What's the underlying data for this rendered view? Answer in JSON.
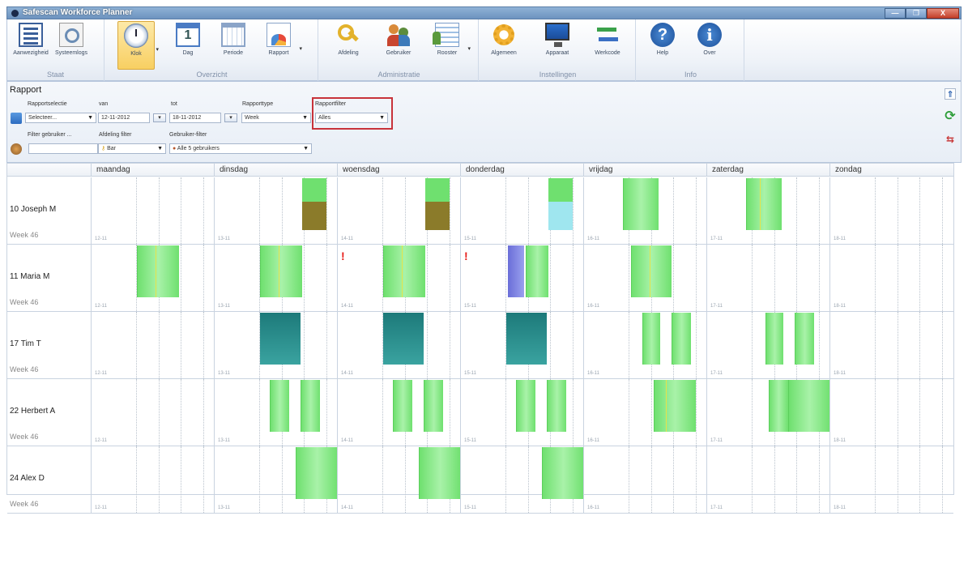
{
  "window": {
    "title": "Safescan Workforce Planner",
    "btn_min": "—",
    "btn_max": "❐",
    "btn_close": "X"
  },
  "ribbon": {
    "groups": [
      {
        "label": "Staat",
        "items": [
          "Aanwezigheid",
          "Systeemlogs"
        ]
      },
      {
        "label": "Overzicht",
        "items": [
          "Klok",
          "Dag",
          "Periode",
          "Rapport"
        ]
      },
      {
        "label": "Administratie",
        "items": [
          "Afdeling",
          "Gebruiker",
          "Rooster"
        ]
      },
      {
        "label": "Instellingen",
        "items": [
          "Algemeen",
          "Apparaat",
          "Werkcode"
        ]
      },
      {
        "label": "Info",
        "items": [
          "Help",
          "Over"
        ]
      }
    ]
  },
  "rapport": {
    "title": "Rapport",
    "rapportselectie_label": "Rapportselectie",
    "rapportselectie_value": "Selecteer...",
    "van_label": "van",
    "van_value": "12-11-2012",
    "tot_label": "tot",
    "tot_value": "18-11-2012",
    "rapporttype_label": "Rapporttype",
    "rapporttype_value": "Week",
    "rapportfilter_label": "Rapportfilter",
    "rapportfilter_value": "Alles",
    "filter_gebruiker_label": "Filter gebruiker ...",
    "filter_gebruiker_value": "",
    "afdeling_filter_label": "Afdeling filter",
    "afdeling_filter_value": "Bar",
    "gebruiker_filter_label": "Gebruiker-filter",
    "gebruiker_filter_value": "Alle 5 gebruikers"
  },
  "planner": {
    "days": [
      "maandag",
      "dinsdag",
      "woensdag",
      "donderdag",
      "vrijdag",
      "zaterdag",
      "zondag"
    ],
    "rows": [
      {
        "name": "10 Joseph M",
        "week": "Week 46",
        "dates": [
          "12-11",
          "13-11",
          "14-11",
          "15-11",
          "16-11",
          "17-11",
          "18-11"
        ]
      },
      {
        "name": "11 Maria M",
        "week": "Week 46",
        "dates": [
          "12-11",
          "13-11",
          "14-11",
          "15-11",
          "16-11",
          "17-11",
          "18-11"
        ]
      },
      {
        "name": "17 Tim T",
        "week": "Week 46",
        "dates": [
          "12-11",
          "13-11",
          "14-11",
          "15-11",
          "16-11",
          "17-11",
          "18-11"
        ]
      },
      {
        "name": "22 Herbert A",
        "week": "Week 46",
        "dates": [
          "12-11",
          "13-11",
          "14-11",
          "15-11",
          "16-11",
          "17-11",
          "18-11"
        ]
      },
      {
        "name": "24 Alex D",
        "week": "Week 46",
        "dates": [
          "12-11",
          "13-11",
          "14-11",
          "15-11",
          "16-11",
          "17-11",
          "18-11"
        ]
      }
    ],
    "warning_symbol": "!"
  },
  "colors": {
    "shift_green": "#6fe06f",
    "shift_teal": "#1d7a7a",
    "highlight_red": "#c8333a"
  },
  "icons": [
    "list-icon",
    "magnifier-icon",
    "clock-icon",
    "calendar-icon",
    "grid-icon",
    "chart-icon",
    "key-icon",
    "users-icon",
    "roster-icon",
    "gear-icon",
    "monitor-icon",
    "arrows-icon",
    "help-icon",
    "info-icon"
  ]
}
